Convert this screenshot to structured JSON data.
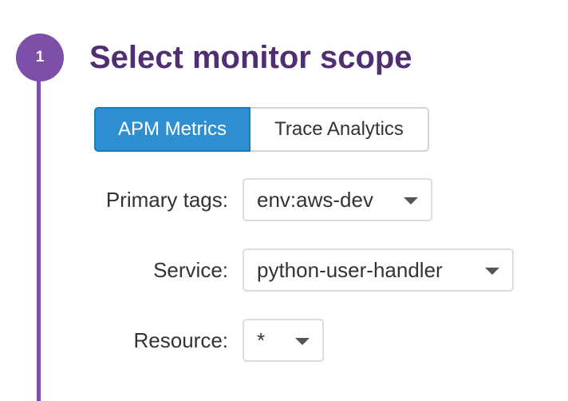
{
  "colors": {
    "step_accent": "#7e4fa8",
    "title": "#4f2f72",
    "active_toggle_bg": "#2f8fd0",
    "active_toggle_text": "#ffffff"
  },
  "step": {
    "number": "1",
    "title": "Select monitor scope"
  },
  "scope_toggle": {
    "options": [
      {
        "label": "APM Metrics",
        "selected": true
      },
      {
        "label": "Trace Analytics",
        "selected": false
      }
    ]
  },
  "fields": {
    "primary_tags": {
      "label": "Primary tags:",
      "value": "env:aws-dev"
    },
    "service": {
      "label": "Service:",
      "value": "python-user-handler"
    },
    "resource": {
      "label": "Resource:",
      "value": "*"
    }
  },
  "icons": {
    "dropdown": "chevron-down-icon"
  }
}
